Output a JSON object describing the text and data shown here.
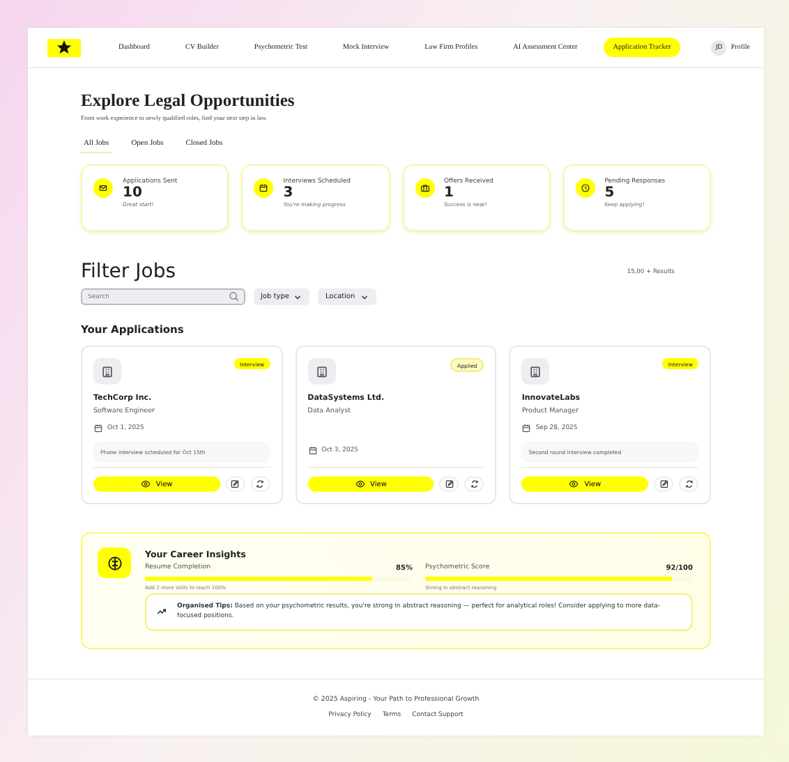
{
  "nav": {
    "items": [
      {
        "label": "Dashboard",
        "selected": false
      },
      {
        "label": "CV Builder",
        "selected": false
      },
      {
        "label": "Psychometric Test",
        "selected": false
      },
      {
        "label": "Mock Interview",
        "selected": false
      },
      {
        "label": "Law Firm Profiles",
        "selected": false
      },
      {
        "label": "AI Assessment Center",
        "selected": false
      },
      {
        "label": "Application Tracker",
        "selected": true
      }
    ],
    "profile": {
      "initials": "JD",
      "label": "Profile"
    }
  },
  "header": {
    "title": "Explore Legal Opportunities",
    "subtitle": "From work experience to newly qualified roles, find your next step in law."
  },
  "tabs": [
    {
      "label": "All Jobs",
      "selected": true
    },
    {
      "label": "Open Jobs",
      "selected": false
    },
    {
      "label": "Closed Jobs",
      "selected": false
    }
  ],
  "stats": [
    {
      "label": "Applications Sent",
      "value": "10",
      "note": "Great start!"
    },
    {
      "label": "Interviews Scheduled",
      "value": "3",
      "note": "You're making progress"
    },
    {
      "label": "Offers Received",
      "value": "1",
      "note": "Success is near!"
    },
    {
      "label": "Pending Responses",
      "value": "5",
      "note": "Keep applying!"
    }
  ],
  "filter": {
    "title": "Filter Jobs",
    "results": "15,00 + Results",
    "search": {
      "placeholder": "Search"
    },
    "dropdowns": [
      "Job type",
      "Location"
    ]
  },
  "applications": {
    "title": "Your Applications",
    "items": [
      {
        "company": "TechCorp Inc.",
        "role": "Software Engineer",
        "date": "Oct 1, 2025",
        "note": "Phone interview scheduled for Oct 15th",
        "status": "Interview",
        "kind": "interview",
        "action": "View"
      },
      {
        "company": "DataSystems Ltd.",
        "role": "Data Analyst",
        "date": "Oct 3, 2025",
        "status": "Applied",
        "kind": "applied",
        "action": "View"
      },
      {
        "company": "InnovateLabs",
        "role": "Product Manager",
        "date": "Sep 28, 2025",
        "note": "Second round interview completed",
        "status": "Interview",
        "kind": "interview",
        "action": "View"
      }
    ]
  },
  "insights": {
    "title": "Your Career Insights",
    "metrics": [
      {
        "label": "Resume Completion",
        "reading": "85%",
        "level": 0.85,
        "note": "Add 2 more skills to reach 100%"
      },
      {
        "label": "Psychometric Score",
        "reading": "92/100",
        "level": 0.92,
        "note": "Strong in abstract reasoning"
      }
    ],
    "tip": "**Organised Tips:** Based on your psychometric results, you're strong in abstract reasoning — perfect for analytical roles! Consider applying to more data-focused positions."
  },
  "footer": {
    "copyright": "© 2025 Aspiring - Your Path to Professional Growth",
    "links": [
      "Privacy Policy",
      "Terms",
      "Contact Support"
    ]
  }
}
